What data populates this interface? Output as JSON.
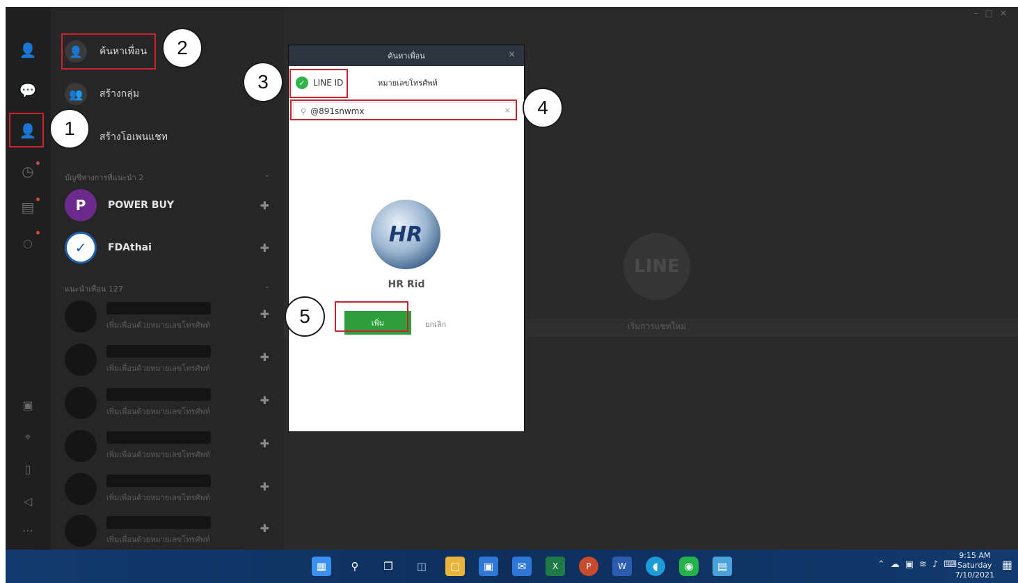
{
  "sidebar": {
    "items": [
      {
        "name": "profile",
        "icon": "person-icon"
      },
      {
        "name": "chats",
        "icon": "chat-bubble-icon"
      },
      {
        "name": "add-friends",
        "icon": "person-add-icon"
      },
      {
        "name": "timeline",
        "icon": "clock-icon"
      },
      {
        "name": "notes",
        "icon": "notes-icon"
      },
      {
        "name": "line-services",
        "icon": "line-circle-icon"
      }
    ],
    "bottom_items": [
      {
        "name": "video-call",
        "icon": "video-icon"
      },
      {
        "name": "screenshot",
        "icon": "crop-icon"
      },
      {
        "name": "keep",
        "icon": "bookmark-icon"
      },
      {
        "name": "announcements",
        "icon": "megaphone-icon"
      },
      {
        "name": "more",
        "icon": "more-icon"
      }
    ]
  },
  "menu": {
    "search_friends": "ค้นหาเพื่อน",
    "create_group": "สร้างกลุ่ม",
    "create_openchat": "สร้างโอเพนแชท"
  },
  "official_accounts": {
    "label": "บัญชีทางการที่แนะนำ 2",
    "items": [
      {
        "name": "POWER BUY",
        "avatar_text": "P",
        "color": "#6b2a8c"
      },
      {
        "name": "FDAthai",
        "avatar_text": "✓",
        "color": "#1d5fa8"
      }
    ]
  },
  "suggested": {
    "label": "แนะนำเพื่อน 127",
    "items": [
      {
        "sub": "เพิ่มเพื่อนด้วยหมายเลขโทรศัพท์"
      },
      {
        "sub": "เพิ่มเพื่อนด้วยหมายเลขโทรศัพท์"
      },
      {
        "sub": "เพิ่มเพื่อนด้วยหมายเลขโทรศัพท์"
      },
      {
        "sub": "เพิ่มเพื่อนด้วยหมายเลขโทรศัพท์"
      },
      {
        "sub": "เพิ่มเพื่อนด้วยหมายเลขโทรศัพท์"
      },
      {
        "sub": "เพิ่มเพื่อนด้วยหมายเลขโทรศัพท์"
      }
    ]
  },
  "main": {
    "logo_text": "LINE",
    "caption": "เริ่มการแชทใหม่"
  },
  "dialog": {
    "title": "ค้นหาเพื่อน",
    "close": "×",
    "tab_line_id": "LINE ID",
    "tab_phone": "หมายเลขโทรศัพท์",
    "search_value": "@891snwmx",
    "search_clear": "×",
    "profile_avatar_text": "HR",
    "profile_name": "HR Rid",
    "add_label": "เพิ่ม",
    "cancel_label": "ยกเลิก"
  },
  "callouts": [
    "1",
    "2",
    "3",
    "4",
    "5"
  ],
  "taskbar": {
    "time": "9:15 AM",
    "day": "Saturday",
    "date": "7/10/2021",
    "apps": [
      {
        "name": "start",
        "icon": "windows-icon",
        "color": "#3b8ff0"
      },
      {
        "name": "search",
        "icon": "search-icon",
        "color": "transparent"
      },
      {
        "name": "task-view",
        "icon": "task-view-icon",
        "color": "transparent"
      },
      {
        "name": "widgets",
        "icon": "widgets-icon",
        "color": "transparent"
      },
      {
        "name": "file-explorer",
        "icon": "folder-icon",
        "color": "#e8b43a"
      },
      {
        "name": "store",
        "icon": "store-icon",
        "color": "#2f77d6"
      },
      {
        "name": "mail",
        "icon": "mail-icon",
        "color": "#2f77d6"
      },
      {
        "name": "excel",
        "icon": "excel-icon",
        "color": "#1e7b45"
      },
      {
        "name": "powerpoint",
        "icon": "powerpoint-icon",
        "color": "#c94a2c"
      },
      {
        "name": "word",
        "icon": "word-icon",
        "color": "#2b5cb0"
      },
      {
        "name": "edge",
        "icon": "edge-icon",
        "color": "#1c9bd6"
      },
      {
        "name": "line",
        "icon": "line-app-icon",
        "color": "#26b24a"
      },
      {
        "name": "notepad",
        "icon": "notepad-icon",
        "color": "#4aa3d8"
      }
    ]
  }
}
